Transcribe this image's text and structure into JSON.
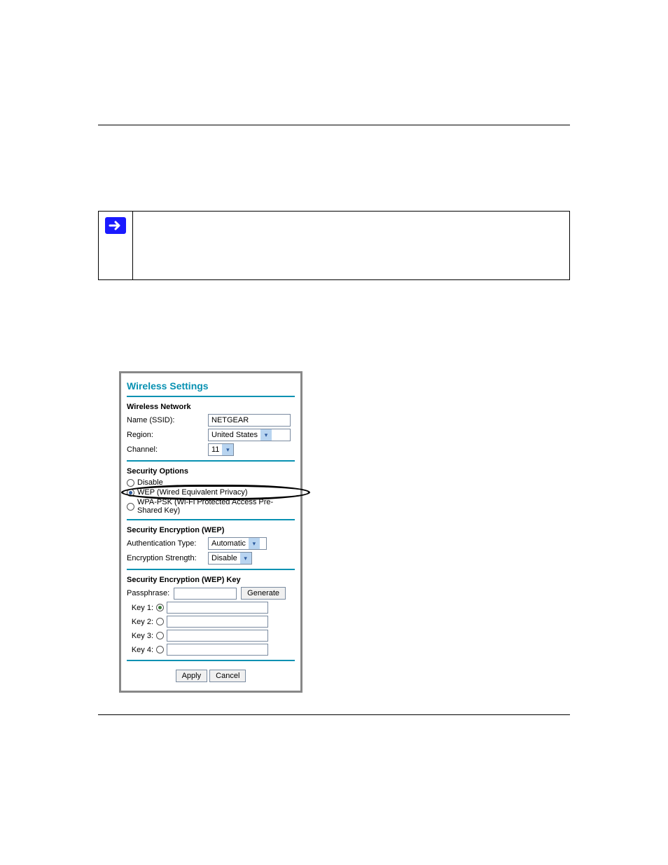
{
  "note": {
    "text": ""
  },
  "panel": {
    "title": "Wireless Settings",
    "network": {
      "heading": "Wireless Network",
      "ssid_label": "Name (SSID):",
      "ssid_value": "NETGEAR",
      "region_label": "Region:",
      "region_value": "United States",
      "channel_label": "Channel:",
      "channel_value": "11"
    },
    "security": {
      "heading": "Security Options",
      "opt_disable": "Disable",
      "opt_wep": "WEP (Wired Equivalent Privacy)",
      "opt_wpa": "WPA-PSK (Wi-Fi Protected Access Pre-Shared Key)"
    },
    "enc": {
      "heading": "Security Encryption (WEP)",
      "auth_label": "Authentication Type:",
      "auth_value": "Automatic",
      "strength_label": "Encryption Strength:",
      "strength_value": "Disable"
    },
    "keys": {
      "heading": "Security Encryption (WEP) Key",
      "passphrase_label": "Passphrase:",
      "generate": "Generate",
      "k1": "Key 1:",
      "k2": "Key 2:",
      "k3": "Key 3:",
      "k4": "Key 4:"
    },
    "actions": {
      "apply": "Apply",
      "cancel": "Cancel"
    }
  }
}
